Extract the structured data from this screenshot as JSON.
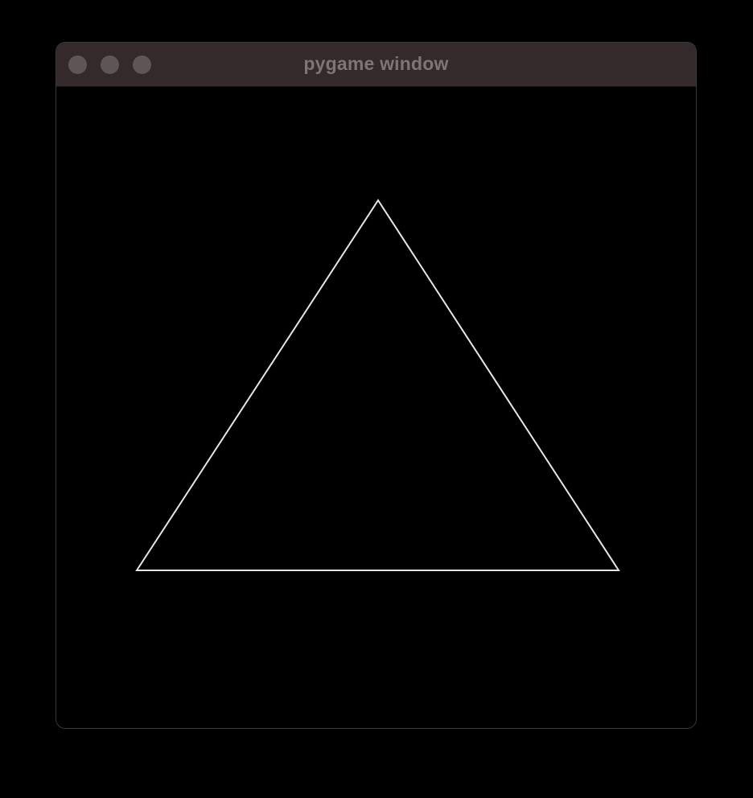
{
  "window": {
    "title": "pygame window",
    "buttons": [
      {
        "name": "close",
        "icon": "circle-icon"
      },
      {
        "name": "minimize",
        "icon": "circle-icon"
      },
      {
        "name": "zoom",
        "icon": "circle-icon"
      }
    ]
  },
  "canvas": {
    "background": "#000000",
    "shape": {
      "type": "triangle",
      "fill": "none",
      "stroke": "#e6e6e6"
    }
  }
}
